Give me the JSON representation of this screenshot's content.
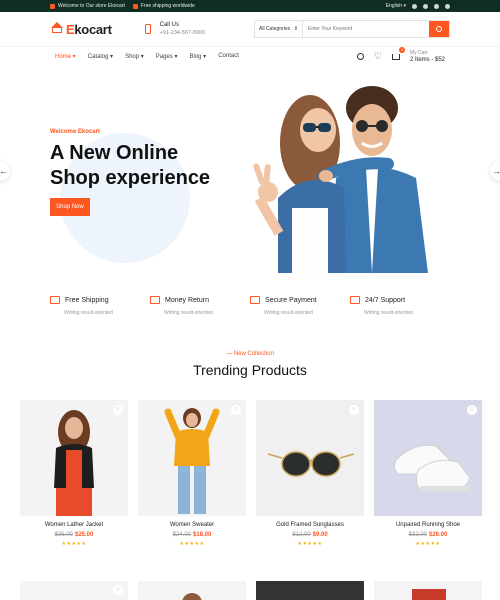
{
  "topbar": {
    "welcome": "Welcome to Our store Ekocart",
    "shipping": "Free shipping worldwide",
    "language": "English"
  },
  "header": {
    "logo_text": "Ekocart",
    "call_label": "Call Us",
    "phone": "+91-234-567-8900",
    "search_category": "All Categories",
    "search_placeholder": "Enter Your Keyword"
  },
  "nav": {
    "items": [
      "Home",
      "Catalog",
      "Shop",
      "Pages",
      "Blog",
      "Contact"
    ],
    "active_index": 0,
    "cart_badge": "0",
    "my_cart_label": "My Cart",
    "cart_summary": "2 Items - $52"
  },
  "hero": {
    "welcome": "Welcome Ekocart",
    "title_line1": "A New Online",
    "title_line2": "Shop experience",
    "button": "Shop Now"
  },
  "features": [
    {
      "title": "Free Shipping",
      "subtitle": "Writing result-oriented"
    },
    {
      "title": "Money Return",
      "subtitle": "Writing result-oriented"
    },
    {
      "title": "Secure Payment",
      "subtitle": "Writing result-oriented"
    },
    {
      "title": "24/7 Support",
      "subtitle": "Writing result-oriented"
    }
  ],
  "section": {
    "subtitle": "— New Collection",
    "title": "Trending Products"
  },
  "products": [
    {
      "name": "Women Lather Jacket",
      "old_price": "$35.00",
      "price": "$25.00",
      "stars": "★★★★★"
    },
    {
      "name": "Women Sweater",
      "old_price": "$24.00",
      "price": "$18.00",
      "stars": "★★★★★"
    },
    {
      "name": "Gold Framed Sunglasses",
      "old_price": "$12.00",
      "price": "$9.00",
      "stars": "★★★★★"
    },
    {
      "name": "Unpaired Running Shoe",
      "old_price": "$32.00",
      "price": "$26.00",
      "stars": "★★★★★"
    }
  ],
  "colors": {
    "accent": "#ff5722",
    "topbar": "#0f2c25"
  }
}
